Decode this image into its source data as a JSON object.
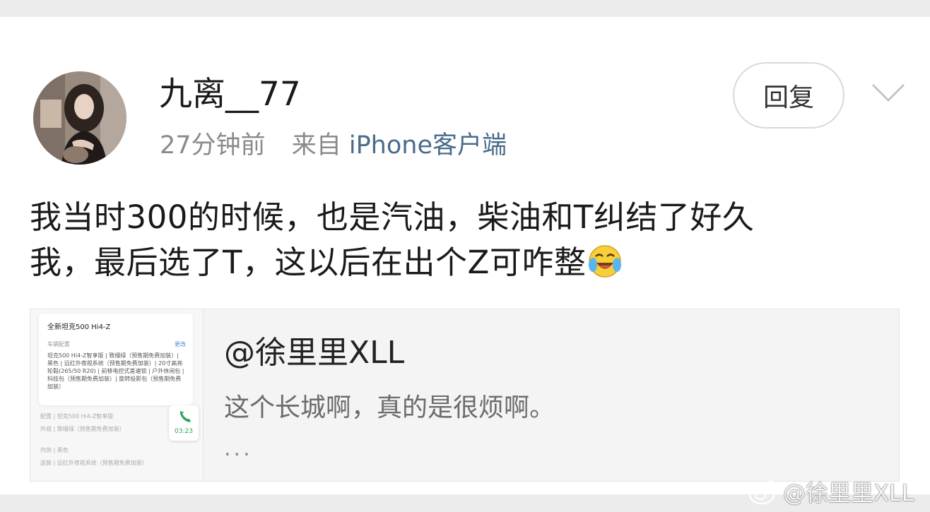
{
  "post": {
    "username": "九离__77",
    "time": "27分钟前",
    "source_prefix": "来自",
    "source_client": "iPhone客户端",
    "reply_label": "回复",
    "text_line1": "我当时300的时候，也是汽油，柴油和T纠结了好久",
    "text_line2": "我，最后选了T，这以后在出个Z可咋整",
    "emoji": "laughing-crying-emoji"
  },
  "quote": {
    "user": "@徐里里XLL",
    "text": "这个长城啊，真的是很烦啊。",
    "ellipsis": "...",
    "thumbnail": {
      "title": "全新坦克500 Hi4-Z",
      "config_label": "车辆配置",
      "more_label": "更改",
      "config_text": "坦克500 Hi4-Z智享版 | 致缦绿（预售期免费加装）| 黑色 | 远红外夜视系统（预售期免费加装）| 20寸高亮轮毂(265/50 R20) | 前移电控式差速锁 | 户外休闲包 | 科技包（预售期免费加装）| 旋转投影包（预售期免费加装）",
      "rows": [
        "配置 | 坦克500 Hi4-Z智享版",
        "外观 | 致缦绿（预售期免费加装）",
        "内饰 | 黑色",
        "选装 | 远红外夜视系统（预售期免费加装）"
      ],
      "call_time": "03:23"
    }
  },
  "watermark": {
    "text": "@徐里里XLL",
    "icon": "weibo-icon"
  },
  "colors": {
    "link_blue": "#4a6b8c",
    "meta_gray": "#8a8a8a",
    "call_green": "#2aa55a"
  }
}
